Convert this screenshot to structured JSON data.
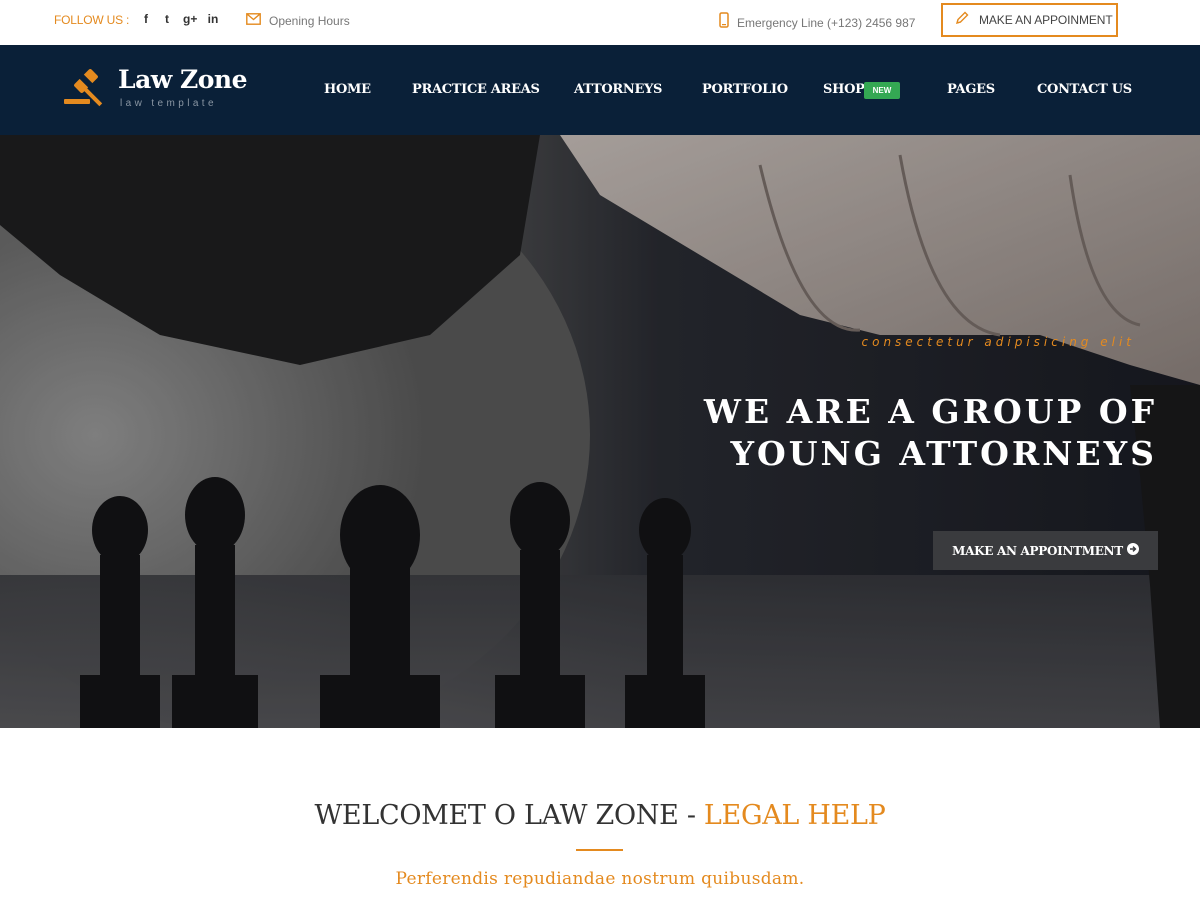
{
  "topbar": {
    "follow_label": "FOLLOW US :",
    "social": [
      {
        "icon": "facebook-icon",
        "glyph": "f"
      },
      {
        "icon": "twitter-icon",
        "glyph": "t"
      },
      {
        "icon": "google-plus-icon",
        "glyph": "g+"
      },
      {
        "icon": "linkedin-icon",
        "glyph": "in"
      }
    ],
    "opening_hours": "Opening Hours",
    "emergency": "Emergency Line (+123) 2456 987",
    "appointment": "MAKE AN APPOINMENT"
  },
  "nav": {
    "logo_name": "Law Zone",
    "logo_tagline": "law template",
    "items": [
      "HOME",
      "PRACTICE AREAS",
      "ATTORNEYS",
      "PORTFOLIO",
      "SHOP",
      "PAGES",
      "CONTACT US"
    ],
    "shop_badge": "NEW"
  },
  "hero": {
    "subtitle": "consectetur adipisicing elit",
    "title_line1": "WE ARE A GROUP OF",
    "title_line2": "YOUNG ATTORNEYS",
    "button": "MAKE AN APPOINTMENT"
  },
  "welcome": {
    "title_main": "WELCOMET O LAW ZONE - ",
    "title_accent": "LEGAL HELP",
    "tagline": "Perferendis repudiandae nostrum quibusdam."
  },
  "colors": {
    "accent": "#e48a1f",
    "navbar": "#0a2038",
    "badge": "#34a853"
  }
}
